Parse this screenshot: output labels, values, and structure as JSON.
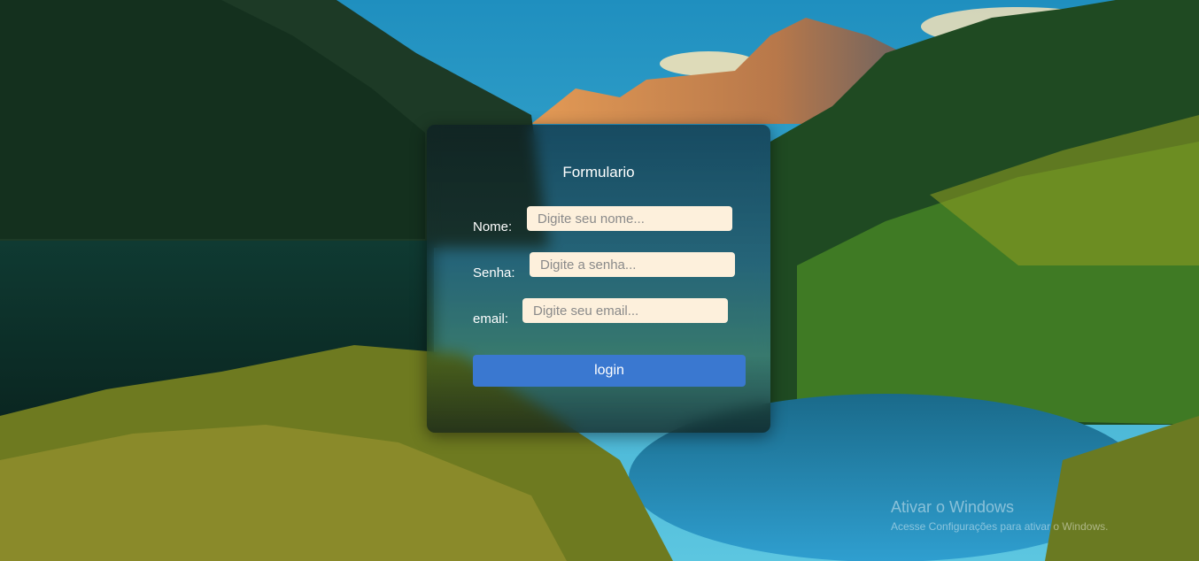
{
  "form": {
    "title": "Formulario",
    "name_label": "Nome:",
    "name_placeholder": "Digite seu nome...",
    "password_label": "Senha:",
    "password_placeholder": "Digite a senha...",
    "email_label": "email:",
    "email_placeholder": "Digite seu email...",
    "login_label": "login"
  },
  "watermark": {
    "title": "Ativar o Windows",
    "subtitle": "Acesse Configurações para ativar o Windows."
  },
  "colors": {
    "button": "#3a78d0",
    "field_background": "#fdf0dc",
    "card_overlay": "rgba(10,25,35,0.6)"
  }
}
